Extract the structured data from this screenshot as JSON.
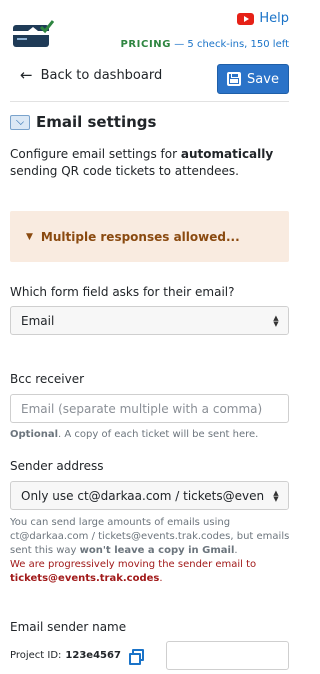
{
  "header": {
    "help_label": "Help",
    "pricing_label": "PRICING",
    "pricing_detail": "— 5 check-ins, 150 left"
  },
  "toolbar": {
    "back_label": "Back to dashboard",
    "save_label": "Save"
  },
  "section": {
    "title": "Email settings",
    "intro_prefix": "Configure email settings for ",
    "intro_bold": "automatically",
    "intro_suffix": " sending QR code tickets to attendees."
  },
  "accordion": {
    "label": "Multiple responses allowed..."
  },
  "form": {
    "email_field_label": "Which form field asks for their email?",
    "email_field_value": "Email",
    "bcc_label": "Bcc receiver",
    "bcc_placeholder": "Email (separate multiple with a comma)",
    "bcc_hint_bold": "Optional",
    "bcc_hint_rest": ". A copy of each ticket will be sent here.",
    "sender_label": "Sender address",
    "sender_value": "Only use ct@darkaa.com / tickets@events.trak.codes",
    "sender_note_1": "You can send large amounts of emails using ct@darkaa.com / tickets@events.trak.codes, but emails sent this way ",
    "sender_note_bold": "won't leave a copy in Gmail",
    "sender_note_2": ".",
    "sender_note_red": "We are progressively moving the sender email to ",
    "sender_note_red_bold": "tickets@events.trak.codes",
    "sender_note_red_end": ".",
    "sender_name_label": "Email sender name"
  },
  "footer": {
    "project_label": "Project ID:",
    "project_id": "123e4567"
  },
  "colors": {
    "primary": "#2b73c8",
    "pricing_green": "#2e8540",
    "accordion_bg": "#f9ebe0",
    "warning_red": "#a11a1a"
  }
}
